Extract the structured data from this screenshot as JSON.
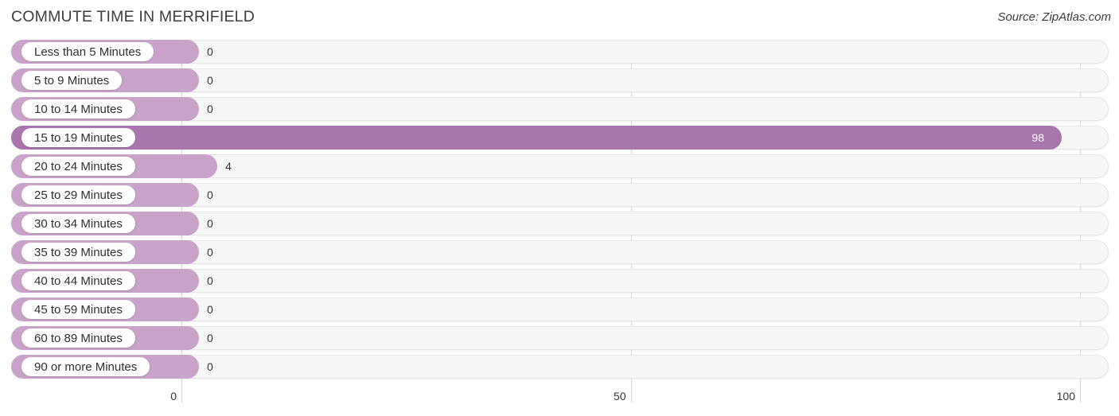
{
  "header": {
    "title": "COMMUTE TIME IN MERRIFIELD",
    "source": "Source: ZipAtlas.com"
  },
  "colors": {
    "bar": "#c9a3c9",
    "bar_highlight": "#a876ad",
    "track": "#f7f7f7",
    "text": "#33333a",
    "gridline": "#d8d8d8"
  },
  "chart_data": {
    "type": "bar",
    "orientation": "horizontal",
    "title": "COMMUTE TIME IN MERRIFIELD",
    "xlabel": "",
    "ylabel": "",
    "xlim": [
      0,
      100
    ],
    "xticks": [
      0,
      50,
      100
    ],
    "xtick_labels": [
      "0",
      "50",
      "100"
    ],
    "grid": true,
    "legend": null,
    "categories": [
      "Less than 5 Minutes",
      "5 to 9 Minutes",
      "10 to 14 Minutes",
      "15 to 19 Minutes",
      "20 to 24 Minutes",
      "25 to 29 Minutes",
      "30 to 34 Minutes",
      "35 to 39 Minutes",
      "40 to 44 Minutes",
      "45 to 59 Minutes",
      "60 to 89 Minutes",
      "90 or more Minutes"
    ],
    "values": [
      0,
      0,
      0,
      98,
      4,
      0,
      0,
      0,
      0,
      0,
      0,
      0
    ],
    "value_labels": [
      "0",
      "0",
      "0",
      "98",
      "4",
      "0",
      "0",
      "0",
      "0",
      "0",
      "0",
      "0"
    ],
    "highlight_index": 3
  }
}
